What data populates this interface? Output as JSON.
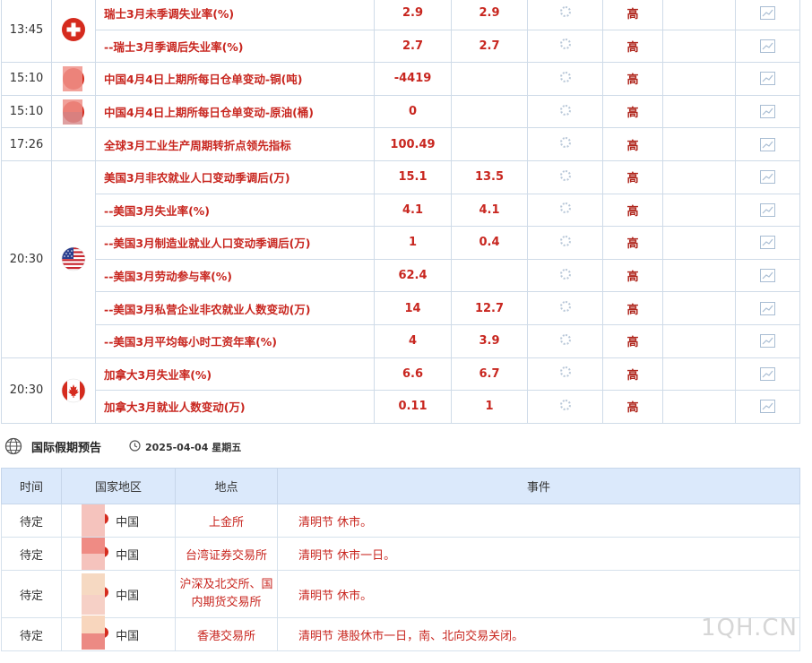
{
  "events": {
    "rows": [
      {
        "time": "13:45",
        "flag": "switzerland-flag",
        "indicator": "瑞士3月未季调失业率(%)",
        "prev": "2.9",
        "forecast": "2.9",
        "importance": "高"
      },
      {
        "time": "",
        "flag": "",
        "indicator": "--瑞士3月季调后失业率(%)",
        "prev": "2.7",
        "forecast": "2.7",
        "importance": "高"
      },
      {
        "time": "15:10",
        "flag": "china-flag",
        "indicator": "中国4月4日上期所每日仓单变动-铜(吨)",
        "prev": "-4419",
        "forecast": "",
        "importance": "高"
      },
      {
        "time": "15:10",
        "flag": "china-flag",
        "indicator": "中国4月4日上期所每日仓单变动-原油(桶)",
        "prev": "0",
        "forecast": "",
        "importance": "高"
      },
      {
        "time": "17:26",
        "flag": "",
        "indicator": "全球3月工业生产周期转折点领先指标",
        "prev": "100.49",
        "forecast": "",
        "importance": "高"
      },
      {
        "time": "20:30",
        "flag": "usa-flag",
        "indicator": "美国3月非农就业人口变动季调后(万)",
        "prev": "15.1",
        "forecast": "13.5",
        "importance": "高"
      },
      {
        "time": "",
        "flag": "",
        "indicator": "--美国3月失业率(%)",
        "prev": "4.1",
        "forecast": "4.1",
        "importance": "高"
      },
      {
        "time": "",
        "flag": "",
        "indicator": "--美国3月制造业就业人口变动季调后(万)",
        "prev": "1",
        "forecast": "0.4",
        "importance": "高"
      },
      {
        "time": "",
        "flag": "",
        "indicator": "--美国3月劳动参与率(%)",
        "prev": "62.4",
        "forecast": "",
        "importance": "高"
      },
      {
        "time": "",
        "flag": "",
        "indicator": "--美国3月私营企业非农就业人数变动(万)",
        "prev": "14",
        "forecast": "12.7",
        "importance": "高"
      },
      {
        "time": "",
        "flag": "",
        "indicator": "--美国3月平均每小时工资年率(%)",
        "prev": "4",
        "forecast": "3.9",
        "importance": "高"
      },
      {
        "time": "20:30",
        "flag": "canada-flag",
        "indicator": "加拿大3月失业率(%)",
        "prev": "6.6",
        "forecast": "6.7",
        "importance": "高"
      },
      {
        "time": "",
        "flag": "",
        "indicator": "加拿大3月就业人数变动(万)",
        "prev": "0.11",
        "forecast": "1",
        "importance": "高"
      }
    ]
  },
  "holiday": {
    "title": "国际假期预告",
    "date": "2025-04-04 星期五",
    "headers": [
      "时间",
      "国家地区",
      "地点",
      "事件"
    ],
    "rows": [
      {
        "time": "待定",
        "country": "中国",
        "place": "上金所",
        "event": "清明节 休市。"
      },
      {
        "time": "待定",
        "country": "中国",
        "place": "台湾证券交易所",
        "event": "清明节 休市一日。"
      },
      {
        "time": "待定",
        "country": "中国",
        "place": "沪深及北交所、国内期货交易所",
        "event": "清明节 休市。"
      },
      {
        "time": "待定",
        "country": "中国",
        "place": "香港交易所",
        "event": "清明节 港股休市一日，南、北向交易关闭。"
      }
    ]
  },
  "watermark": "1QH.CN",
  "colors": {
    "accent_red": "#c8261f",
    "border": "#cfdbe8",
    "header_bg": "#dbe9fb"
  }
}
